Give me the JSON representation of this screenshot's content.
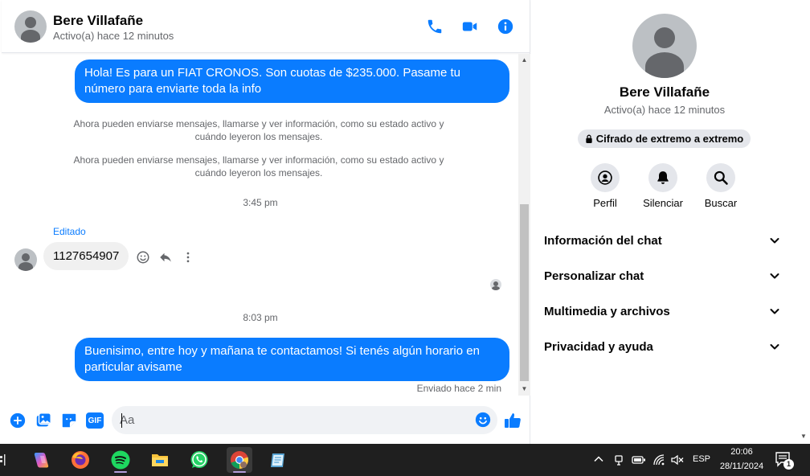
{
  "contact": {
    "name": "Bere Villafañe",
    "status": "Activo(a) hace 12 minutos"
  },
  "header": {
    "call_icon": "phone-icon",
    "video_icon": "video-camera-icon",
    "info_icon": "info-icon"
  },
  "messages": {
    "out_1": "Hola! Es para un FIAT CRONOS. Son cuotas de $235.000. Pasame tu número para enviarte toda la info",
    "system_1": "Ahora pueden enviarse mensajes, llamarse y ver información, como su estado activo y cuándo leyeron los mensajes.",
    "system_2": "Ahora pueden enviarse mensajes, llamarse y ver información, como su estado activo y cuándo leyeron los mensajes.",
    "time_1": "3:45 pm",
    "edited_label": "Editado",
    "in_1": "1127654907",
    "time_2": "8:03 pm",
    "out_2": "Buenisimo, entre hoy y mañana te contactamos! Si tenés algún horario en particular avisame",
    "sent_status": "Enviado hace 2 min"
  },
  "composer": {
    "placeholder": "Aa",
    "gif_label": "GIF"
  },
  "info_panel": {
    "name": "Bere Villafañe",
    "status": "Activo(a) hace 12 minutos",
    "encryption": "Cifrado de extremo a extremo",
    "actions": [
      {
        "label": "Perfil",
        "icon": "profile-icon"
      },
      {
        "label": "Silenciar",
        "icon": "bell-icon"
      },
      {
        "label": "Buscar",
        "icon": "search-icon"
      }
    ],
    "sections": [
      {
        "label": "Información del chat"
      },
      {
        "label": "Personalizar chat"
      },
      {
        "label": "Multimedia y archivos"
      },
      {
        "label": "Privacidad y ayuda"
      }
    ]
  },
  "taskbar": {
    "apps": [
      "copilot-icon",
      "firefox-icon",
      "spotify-icon",
      "file-explorer-icon",
      "whatsapp-icon",
      "chrome-icon",
      "notepad-icon"
    ],
    "language": "ESP",
    "time": "20:06",
    "date": "28/11/2024",
    "notification_count": "1"
  },
  "colors": {
    "accent": "#0a7cff",
    "taskbar": "#1f1f1f"
  }
}
